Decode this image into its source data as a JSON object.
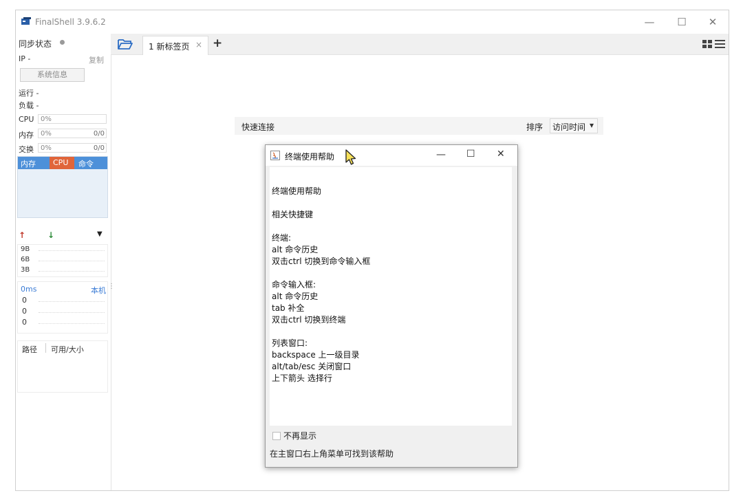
{
  "app": {
    "title": "FinalShell 3.9.6.2"
  },
  "window_controls": {
    "minimize": "—",
    "maximize": "☐",
    "close": "✕"
  },
  "sidebar": {
    "sync_label": "同步状态",
    "ip_label": "IP -",
    "copy_label": "复制",
    "sysinfo_button": "系统信息",
    "uptime_label": "运行 -",
    "load_label": "负载 -",
    "cpu": {
      "label": "CPU",
      "value": "0%"
    },
    "mem": {
      "label": "内存",
      "value": "0%",
      "ratio": "0/0"
    },
    "swap": {
      "label": "交换",
      "value": "0%",
      "ratio": "0/0"
    },
    "chart_tabs": {
      "mem": "内存",
      "cpu": "CPU",
      "cmd": "命令"
    },
    "net": {
      "up_arrow": "↑",
      "down_arrow": "↓",
      "menu_arrow": "▼",
      "ticks": [
        "9B",
        "6B",
        "3B"
      ]
    },
    "ping": {
      "latency": "0ms",
      "host": "本机",
      "ticks": [
        "0",
        "0",
        "0"
      ]
    },
    "disk": {
      "col_path": "路径",
      "col_size": "可用/大小"
    }
  },
  "tabs": {
    "items": [
      {
        "label": "1 新标签页",
        "close": "×"
      }
    ],
    "add_button": "+"
  },
  "quick_connect": {
    "title": "快速连接",
    "sort_label": "排序",
    "sort_value": "访问时间",
    "sort_arrow": "▾"
  },
  "dialog": {
    "title": "终端使用帮助",
    "lines": [
      "终端使用帮助",
      "",
      "相关快捷键",
      "",
      "终端:",
      "alt 命令历史",
      "双击ctrl 切换到命令输入框",
      "",
      "命令输入框:",
      "alt 命令历史",
      "tab 补全",
      "双击ctrl 切换到终端",
      "",
      "列表窗口:",
      "backspace 上一级目录",
      "alt/tab/esc 关闭窗口",
      "上下箭头 选择行"
    ],
    "checkbox_label": "不再显示",
    "hint": "在主窗口右上角菜单可找到该帮助",
    "controls": {
      "minimize": "—",
      "maximize": "☐",
      "close": "✕"
    }
  }
}
